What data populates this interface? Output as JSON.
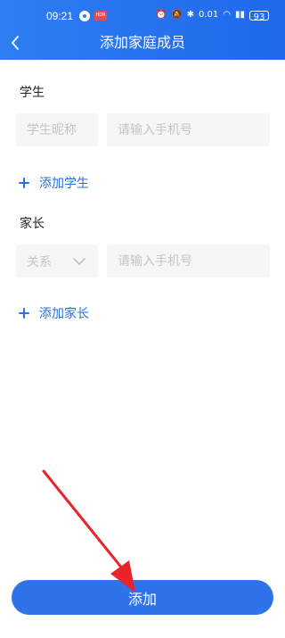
{
  "status_bar": {
    "time": "09:21",
    "speed": "0.01",
    "battery": "93"
  },
  "header": {
    "title": "添加家庭成员"
  },
  "students": {
    "section_title": "学生",
    "nickname_placeholder": "学生昵称",
    "phone_placeholder": "请输入手机号",
    "add_label": "添加学生"
  },
  "parents": {
    "section_title": "家长",
    "relation_placeholder": "关系",
    "phone_placeholder": "请输入手机号",
    "add_label": "添加家长"
  },
  "footer": {
    "submit_label": "添加"
  },
  "colors": {
    "brand": "#2f73ea",
    "link": "#2b6fe0",
    "annotation_arrow": "#e8242a"
  }
}
